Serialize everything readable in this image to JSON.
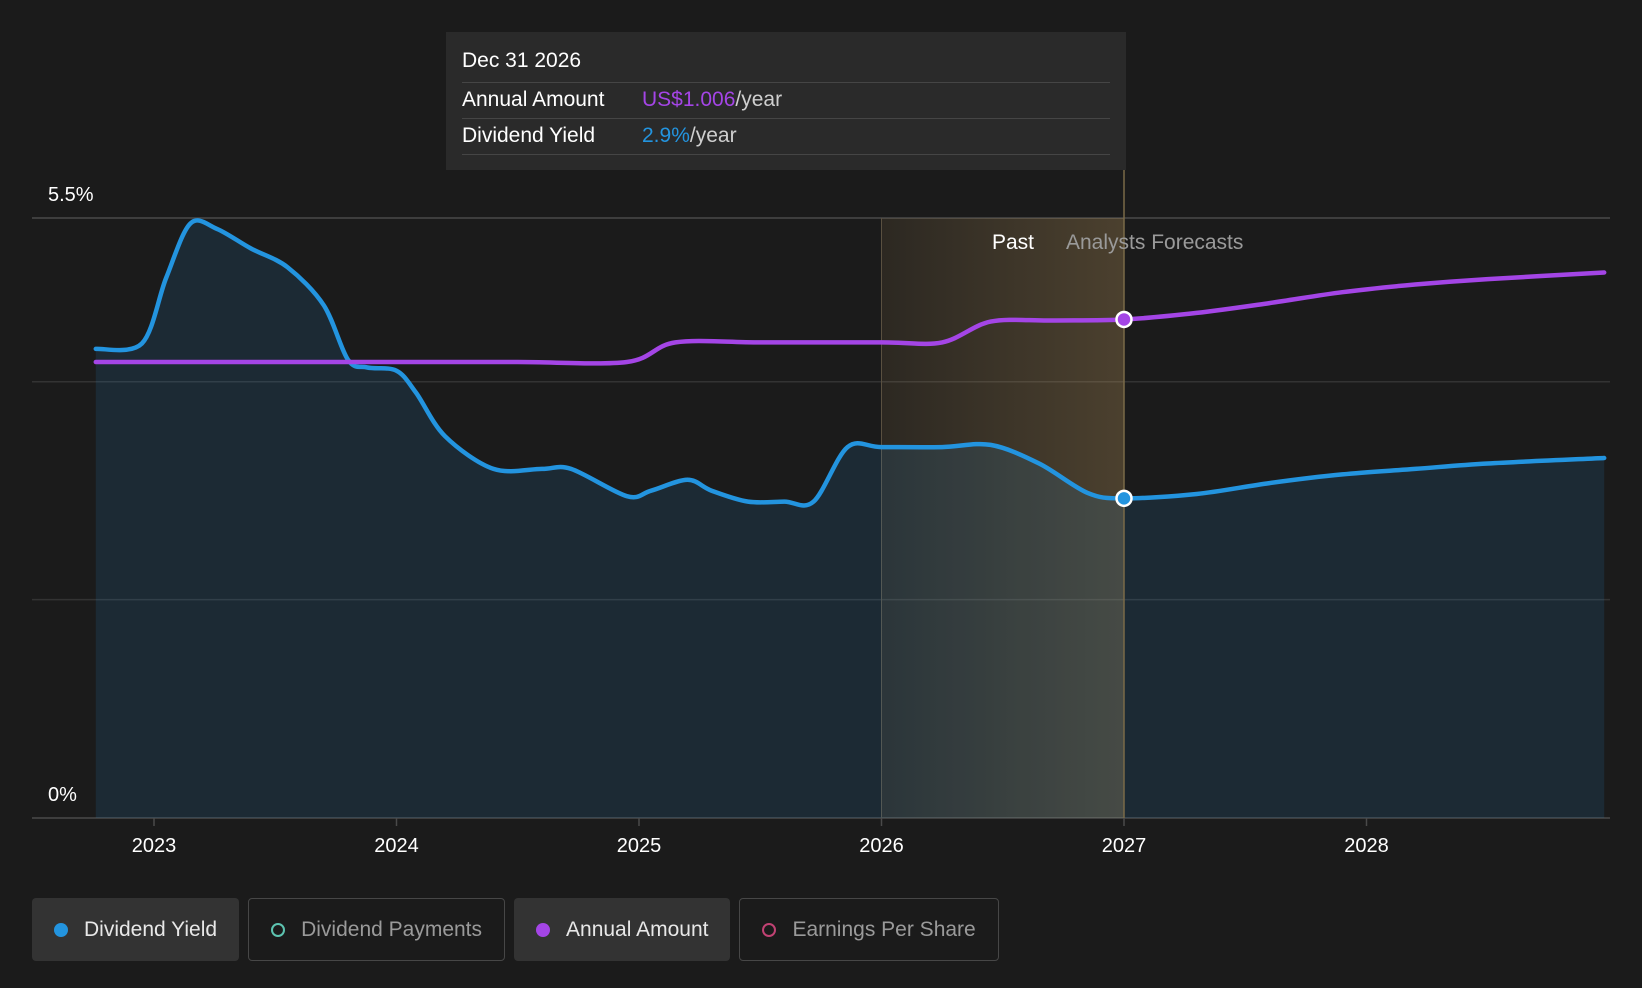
{
  "tooltip": {
    "date": "Dec 31 2026",
    "annual_amount_label": "Annual Amount",
    "annual_amount_value": "US$1.006",
    "dividend_yield_label": "Dividend Yield",
    "dividend_yield_value": "2.9%",
    "unit": "/year"
  },
  "legend": [
    {
      "label": "Dividend Yield",
      "color": "#2394df",
      "active": true
    },
    {
      "label": "Dividend Payments",
      "color": "#5dc3b0",
      "active": false
    },
    {
      "label": "Annual Amount",
      "color": "#a445e6",
      "active": true
    },
    {
      "label": "Earnings Per Share",
      "color": "#c14273",
      "active": false
    }
  ],
  "chart_data": {
    "type": "line",
    "y_tick_labels": [
      "5.5%",
      "0%"
    ],
    "ylim": [
      0,
      5.5
    ],
    "xlim": [
      2022.5,
      2028.98
    ],
    "x_ticks": [
      2023,
      2024,
      2025,
      2026,
      2027,
      2028
    ],
    "region_labels": {
      "past": "Past",
      "forecast": "Analysts Forecasts"
    },
    "highlight_range": [
      2026.0,
      2027.0
    ],
    "forecast_start": 2027.0,
    "selected_x": 2027.0,
    "colors": {
      "yield": "#2394df",
      "amount": "#a445e6",
      "highlight": "#c8a060"
    },
    "series": [
      {
        "name": "Dividend Yield",
        "color": "#2394df",
        "x": [
          2022.76,
          2022.95,
          2023.05,
          2023.15,
          2023.26,
          2023.4,
          2023.55,
          2023.7,
          2023.8,
          2023.88,
          2024.0,
          2024.08,
          2024.2,
          2024.4,
          2024.6,
          2024.72,
          2024.95,
          2025.05,
          2025.2,
          2025.3,
          2025.45,
          2025.6,
          2025.72,
          2025.86,
          2026.0,
          2026.25,
          2026.45,
          2026.65,
          2026.85,
          2027.0,
          2027.3,
          2027.6,
          2027.9,
          2028.2,
          2028.5,
          2028.98
        ],
        "values": [
          4.3,
          4.35,
          4.95,
          5.45,
          5.4,
          5.22,
          5.05,
          4.7,
          4.2,
          4.13,
          4.1,
          3.9,
          3.5,
          3.2,
          3.2,
          3.2,
          2.95,
          3.0,
          3.1,
          3.0,
          2.9,
          2.9,
          2.9,
          3.4,
          3.4,
          3.4,
          3.42,
          3.25,
          2.98,
          2.93,
          2.97,
          3.07,
          3.15,
          3.2,
          3.25,
          3.3
        ]
      },
      {
        "name": "Annual Amount",
        "color": "#a445e6",
        "x": [
          2022.76,
          2023.5,
          2024.0,
          2024.5,
          2024.95,
          2025.15,
          2025.5,
          2026.0,
          2026.25,
          2026.45,
          2026.7,
          2027.0,
          2027.3,
          2027.6,
          2027.9,
          2028.2,
          2028.5,
          2028.98
        ],
        "values": [
          4.18,
          4.18,
          4.18,
          4.18,
          4.18,
          4.36,
          4.36,
          4.36,
          4.36,
          4.55,
          4.56,
          4.57,
          4.63,
          4.72,
          4.82,
          4.89,
          4.94,
          5.0
        ]
      }
    ]
  }
}
